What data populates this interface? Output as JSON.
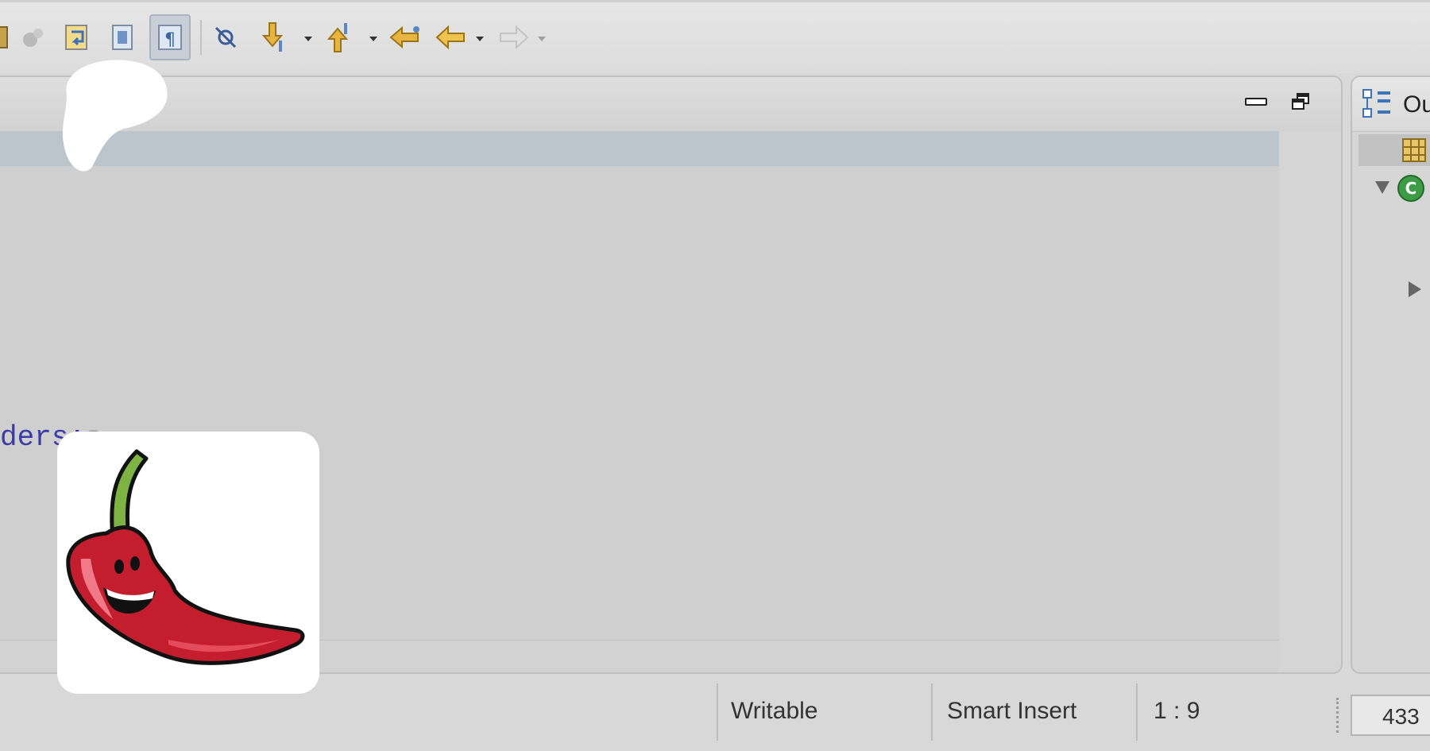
{
  "toolbar": {
    "buttons": [
      {
        "name": "build-icon"
      },
      {
        "name": "run-icon"
      },
      {
        "name": "toggle-word-wrap-icon"
      },
      {
        "name": "block-selection-icon"
      },
      {
        "name": "show-whitespace-icon",
        "pressed": true
      },
      {
        "name": "skip-breakpoints-icon"
      },
      {
        "name": "next-annotation-icon",
        "has_dropdown": true
      },
      {
        "name": "previous-annotation-icon",
        "has_dropdown": true
      },
      {
        "name": "last-edit-location-icon"
      },
      {
        "name": "back-icon",
        "has_dropdown": true
      },
      {
        "name": "forward-icon",
        "has_dropdown": true,
        "disabled": true
      }
    ]
  },
  "editor": {
    "code_line": "ders;",
    "pilcrow": "¶",
    "controls": {
      "minimize": "minimize-icon",
      "maximize": "maximize-icon"
    }
  },
  "outline": {
    "title": "Ou",
    "items": [
      {
        "icon": "import-declarations-icon",
        "selected": true
      },
      {
        "icon": "class-icon",
        "expanded": true
      },
      {
        "icon": "expand-arrow-icon",
        "expanded": false
      }
    ]
  },
  "status": {
    "writable": "Writable",
    "insert_mode": "Smart Insert",
    "position": "1 : 9",
    "memory": "433"
  },
  "colors": {
    "current_line": "#bcc4cc",
    "keyword_blue": "#3a3aa8",
    "chili_red": "#c41e2e",
    "stem_green": "#7cb342"
  }
}
